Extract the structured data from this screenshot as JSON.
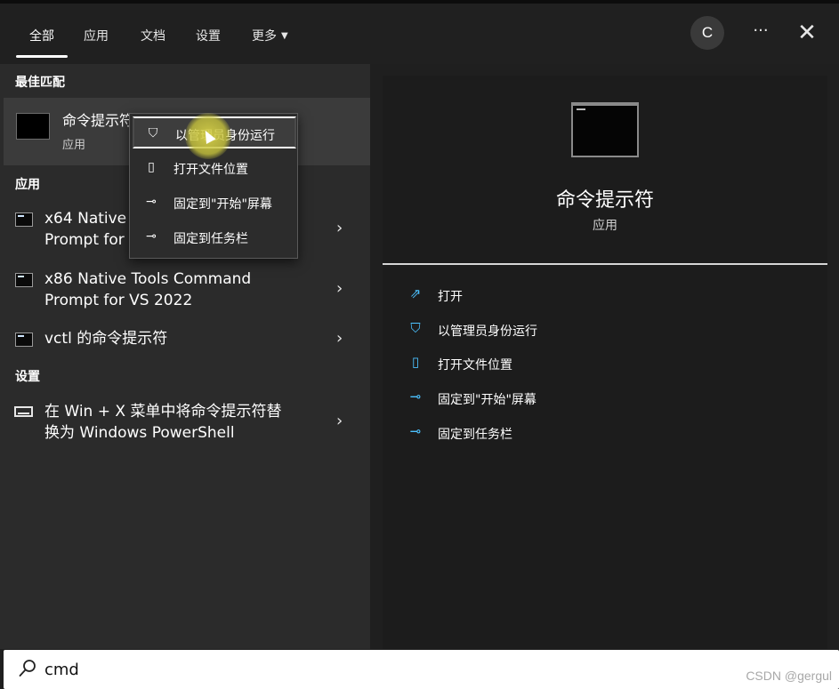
{
  "tabs": [
    {
      "label": "全部",
      "active": true
    },
    {
      "label": "应用"
    },
    {
      "label": "文档"
    },
    {
      "label": "设置"
    },
    {
      "label": "更多"
    }
  ],
  "header": {
    "avatar_letter": "C",
    "more_glyph": "···",
    "close_glyph": "✕"
  },
  "left": {
    "best_match_title": "最佳匹配",
    "best_match": {
      "name": "命令提示符",
      "type": "应用",
      "icon": "cmd-icon"
    },
    "apps_title": "应用",
    "apps": [
      {
        "label": "x64 Native Tools Command\nPrompt for VS 2022",
        "icon": "cmd-icon"
      },
      {
        "label": "x86 Native Tools Command\nPrompt for VS 2022",
        "icon": "cmd-icon"
      },
      {
        "label": "vctl 的命令提示符",
        "icon": "cmd-icon"
      }
    ],
    "settings_title": "设置",
    "settings": [
      {
        "label": "在 Win + X 菜单中将命令提示符替\n换为 Windows PowerShell",
        "icon": "taskbar-settings-icon"
      }
    ],
    "chevron": "›"
  },
  "context_menu": {
    "items": [
      {
        "label": "以管理员身份运行",
        "icon": "shield-run-icon",
        "glyph": "⛉",
        "highlighted": true
      },
      {
        "label": "打开文件位置",
        "icon": "folder-open-icon",
        "glyph": "▯"
      },
      {
        "label": "固定到\"开始\"屏幕",
        "icon": "pin-icon",
        "glyph": "⊸"
      },
      {
        "label": "固定到任务栏",
        "icon": "pin-icon",
        "glyph": "⊸"
      }
    ]
  },
  "preview": {
    "title": "命令提示符",
    "type": "应用",
    "actions": [
      {
        "label": "打开",
        "icon": "open-icon",
        "glyph": "⇗"
      },
      {
        "label": "以管理员身份运行",
        "icon": "shield-run-icon",
        "glyph": "⛉"
      },
      {
        "label": "打开文件位置",
        "icon": "folder-open-icon",
        "glyph": "▯"
      },
      {
        "label": "固定到\"开始\"屏幕",
        "icon": "pin-icon",
        "glyph": "⊸"
      },
      {
        "label": "固定到任务栏",
        "icon": "pin-icon",
        "glyph": "⊸"
      }
    ]
  },
  "search": {
    "value": "cmd",
    "watermark": "CSDN @gergul"
  },
  "colors": {
    "accent": "#4cc2ff",
    "panel_left": "#2b2b2b",
    "panel_right": "#1c1c1c",
    "highlight_row": "#3b3b3b"
  }
}
